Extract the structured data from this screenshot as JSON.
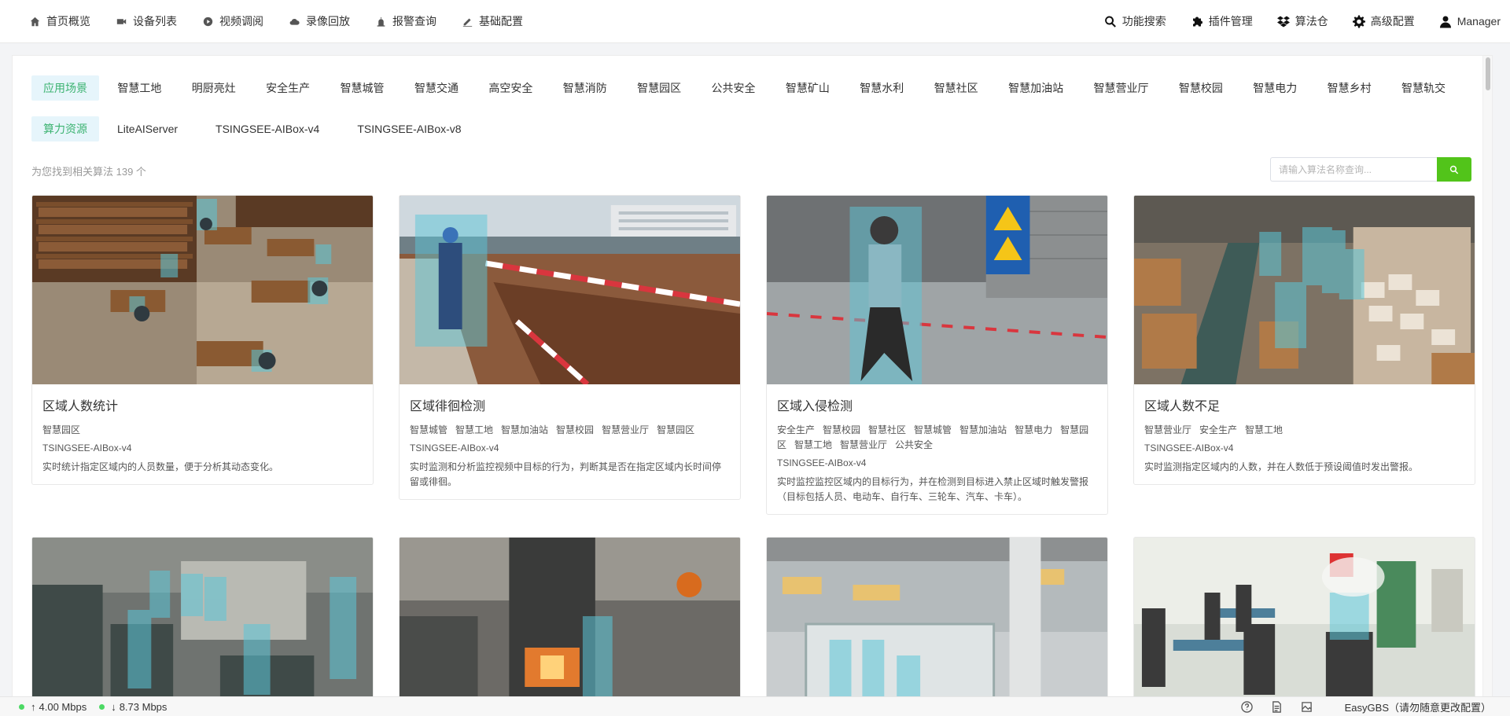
{
  "nav": {
    "left": [
      {
        "label": "首页概览",
        "icon": "home-icon"
      },
      {
        "label": "设备列表",
        "icon": "camera-icon"
      },
      {
        "label": "视频调阅",
        "icon": "play-icon"
      },
      {
        "label": "录像回放",
        "icon": "cloud-icon"
      },
      {
        "label": "报警查询",
        "icon": "alarm-icon"
      },
      {
        "label": "基础配置",
        "icon": "edit-icon"
      }
    ],
    "right": [
      {
        "label": "功能搜索",
        "icon": "search-icon"
      },
      {
        "label": "插件管理",
        "icon": "puzzle-icon"
      },
      {
        "label": "算法仓",
        "icon": "dropbox-icon"
      },
      {
        "label": "高级配置",
        "icon": "gear-icon"
      },
      {
        "label": "Manager",
        "icon": "user-icon"
      }
    ]
  },
  "filters": {
    "scene_label": "应用场景",
    "scenes": [
      "智慧工地",
      "明厨亮灶",
      "安全生产",
      "智慧城管",
      "智慧交通",
      "高空安全",
      "智慧消防",
      "智慧园区",
      "公共安全",
      "智慧矿山",
      "智慧水利",
      "智慧社区",
      "智慧加油站",
      "智慧营业厅",
      "智慧校园",
      "智慧电力",
      "智慧乡村",
      "智慧轨交"
    ],
    "compute_label": "算力资源",
    "compute": [
      "LiteAIServer",
      "TSINGSEE-AIBox-v4",
      "TSINGSEE-AIBox-v8"
    ]
  },
  "results": {
    "count_text": "为您找到相关算法 139 个"
  },
  "search": {
    "placeholder": "请输入算法名称查询..."
  },
  "cards": [
    {
      "title": "区域人数统计",
      "tags": [
        "智慧园区"
      ],
      "device": "TSINGSEE-AIBox-v4",
      "desc": "实时统计指定区域内的人员数量，便于分析其动态变化。",
      "scene": "library"
    },
    {
      "title": "区域徘徊检测",
      "tags": [
        "智慧城管",
        "智慧工地",
        "智慧加油站",
        "智慧校园",
        "智慧营业厅",
        "智慧园区"
      ],
      "device": "TSINGSEE-AIBox-v4",
      "desc": "实时监测和分析监控视频中目标的行为，判断其是否在指定区域内长时间停留或徘徊。",
      "scene": "construction"
    },
    {
      "title": "区域入侵检测",
      "tags": [
        "安全生产",
        "智慧校园",
        "智慧社区",
        "智慧城管",
        "智慧加油站",
        "智慧电力",
        "智慧园区",
        "智慧工地",
        "智慧营业厅",
        "公共安全"
      ],
      "device": "TSINGSEE-AIBox-v4",
      "desc": "实时监控监控区域内的目标行为，并在检测到目标进入禁止区域时触发警报（目标包括人员、电动车、自行车、三轮车、汽车、卡车）。",
      "scene": "intrusion"
    },
    {
      "title": "区域人数不足",
      "tags": [
        "智慧营业厅",
        "安全生产",
        "智慧工地"
      ],
      "device": "TSINGSEE-AIBox-v4",
      "desc": "实时监测指定区域内的人数，并在人数低于预设阈值时发出警报。",
      "scene": "warehouse"
    },
    {
      "scene": "factory"
    },
    {
      "scene": "forge"
    },
    {
      "scene": "lobby"
    },
    {
      "scene": "waiting-room"
    }
  ],
  "status": {
    "up": "4.00 Mbps",
    "down": "8.73 Mbps",
    "app": "EasyGBS（请勿随意更改配置）"
  }
}
